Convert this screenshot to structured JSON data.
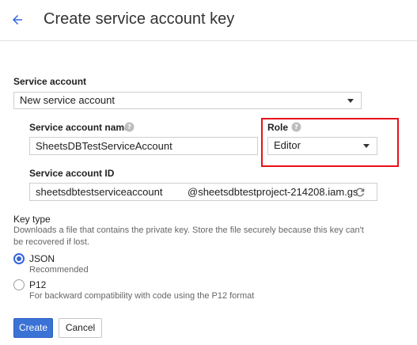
{
  "header": {
    "title": "Create service account key"
  },
  "service_account": {
    "label": "Service account",
    "selected": "New service account"
  },
  "service_account_name": {
    "label": "Service account name",
    "value": "SheetsDBTestServiceAccount"
  },
  "role": {
    "label": "Role",
    "selected": "Editor",
    "highlight_color": "#e8101a"
  },
  "service_account_id": {
    "label": "Service account ID",
    "value": "sheetsdbtestserviceaccount",
    "suffix": "@sheetsdbtestproject-214208.iam.gs"
  },
  "key_type": {
    "label": "Key type",
    "description_line1": "Downloads a file that contains the private key. Store the file securely because this key can't",
    "description_line2": "be recovered if lost.",
    "options": [
      {
        "label": "JSON",
        "sublabel": "Recommended",
        "checked": true
      },
      {
        "label": "P12",
        "sublabel": "For backward compatibility with code using the P12 format",
        "checked": false
      }
    ]
  },
  "actions": {
    "create_label": "Create",
    "cancel_label": "Cancel"
  },
  "colors": {
    "accent": "#3367d6",
    "primary_button": "#3b72d6"
  },
  "icons": {
    "back": "arrow-back-icon",
    "help": "help-circle-icon",
    "refresh": "refresh-icon",
    "dropdown": "caret-down-icon"
  }
}
